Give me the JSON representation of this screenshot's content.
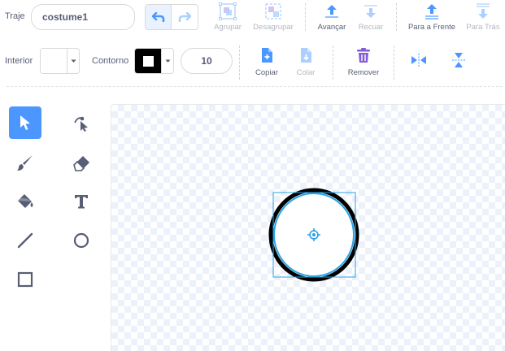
{
  "costume": {
    "label": "Traje",
    "name_value": "costume1"
  },
  "toolbar": {
    "group_label": "Agrupar",
    "ungroup_label": "Desagrupar",
    "forward_label": "Avançar",
    "backward_label": "Recuar",
    "front_label": "Para a Frente",
    "back_label": "Para Trás",
    "copy_label": "Copiar",
    "paste_label": "Colar",
    "delete_label": "Remover"
  },
  "style": {
    "fill_label": "Interior",
    "outline_label": "Contorno",
    "outline_width": "10",
    "fill_color": "#ffffff",
    "outline_color": "#000000"
  },
  "tools": [
    {
      "name": "select",
      "icon": "arrow-select-icon",
      "active": true
    },
    {
      "name": "reshape",
      "icon": "reshape-icon",
      "active": false
    },
    {
      "name": "brush",
      "icon": "brush-icon",
      "active": false
    },
    {
      "name": "eraser",
      "icon": "eraser-icon",
      "active": false
    },
    {
      "name": "fill",
      "icon": "paint-bucket-icon",
      "active": false
    },
    {
      "name": "text",
      "icon": "text-icon",
      "active": false
    },
    {
      "name": "line",
      "icon": "line-icon",
      "active": false
    },
    {
      "name": "circle",
      "icon": "circle-icon",
      "active": false
    },
    {
      "name": "rectangle",
      "icon": "rectangle-icon",
      "active": false
    }
  ],
  "colors": {
    "accent": "#4c97ff",
    "selection": "#29a3e6",
    "text": "#575e75",
    "delete_icon": "#855cd6"
  }
}
